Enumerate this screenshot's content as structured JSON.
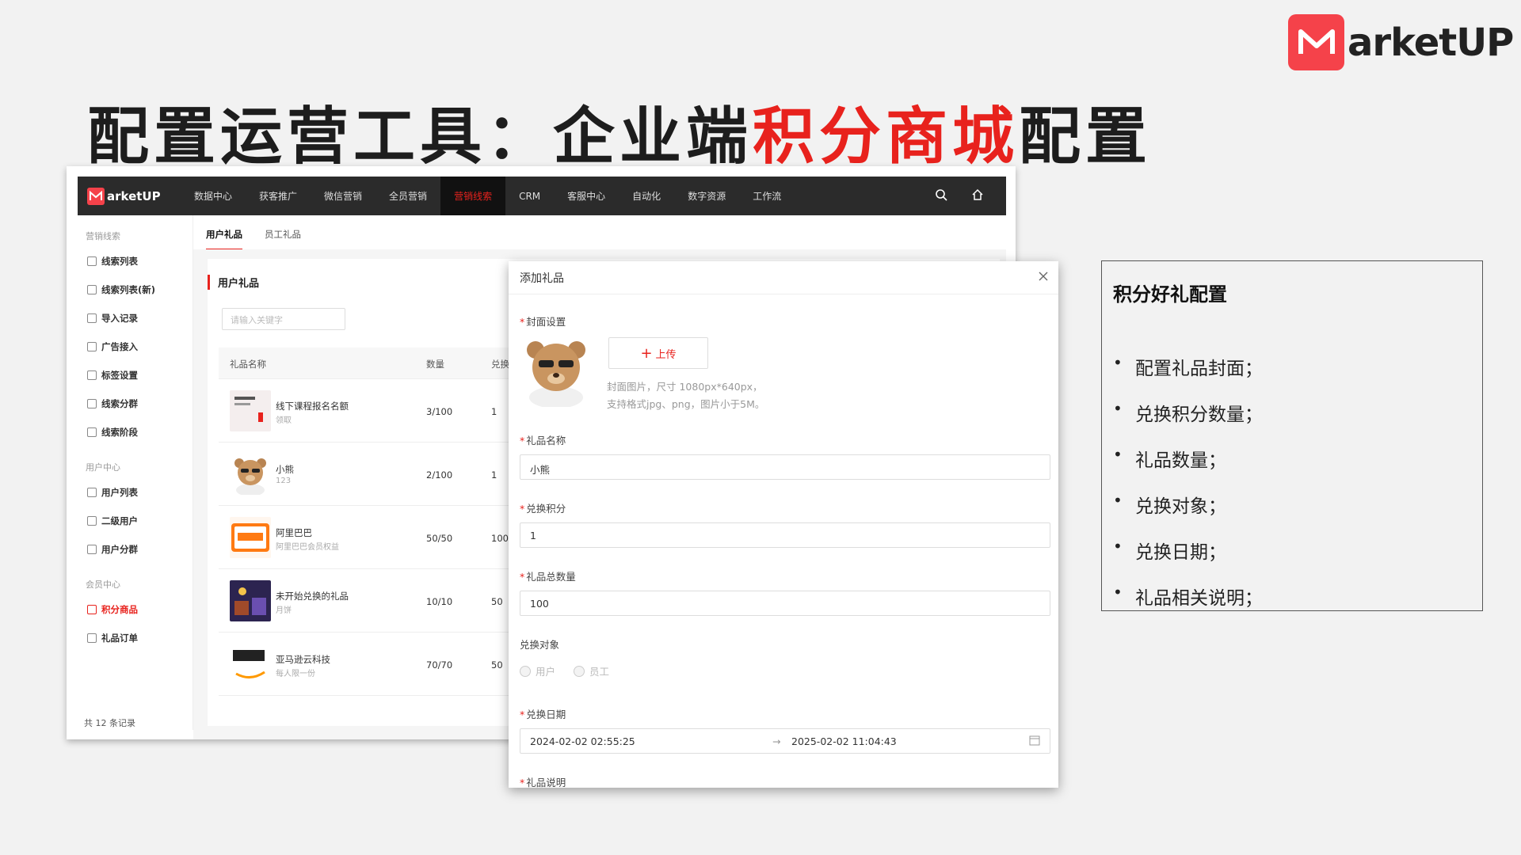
{
  "brand": {
    "name": "arketUP"
  },
  "title": {
    "prefix": "配置运营工具：企业端",
    "highlight": "积分商城",
    "suffix": "配置"
  },
  "app": {
    "nav_logo": "arketUP",
    "nav": [
      "数据中心",
      "获客推广",
      "微信营销",
      "全员营销",
      "营销线索",
      "CRM",
      "客服中心",
      "自动化",
      "数字资源",
      "工作流"
    ],
    "sidebar": {
      "groups": [
        {
          "title": "营销线索",
          "items": [
            "线索列表",
            "线索列表(新)",
            "导入记录",
            "广告接入",
            "标签设置",
            "线索分群",
            "线索阶段"
          ]
        },
        {
          "title": "用户中心",
          "items": [
            "用户列表",
            "二级用户",
            "用户分群"
          ]
        },
        {
          "title": "会员中心",
          "items": [
            "积分商品",
            "礼品订单"
          ]
        }
      ]
    },
    "tabs": [
      "用户礼品",
      "员工礼品"
    ],
    "card_title": "用户礼品",
    "search_placeholder": "请输入关键字",
    "columns": [
      "礼品名称",
      "数量",
      "兑换"
    ],
    "rows": [
      {
        "name": "线下课程报名名额",
        "sub": "领取",
        "qty": "3/100",
        "points": "1"
      },
      {
        "name": "小熊",
        "sub": "123",
        "qty": "2/100",
        "points": "1"
      },
      {
        "name": "阿里巴巴",
        "sub": "阿里巴巴会员权益",
        "qty": "50/50",
        "points": "100"
      },
      {
        "name": "未开始兑换的礼品",
        "sub": "月饼",
        "qty": "10/10",
        "points": "50"
      },
      {
        "name": "亚马逊云科技",
        "sub": "每人限一份",
        "qty": "70/70",
        "points": "50"
      }
    ],
    "total": "共 12 条记录"
  },
  "modal": {
    "title": "添加礼品",
    "cover_label": "封面设置",
    "upload_label": "上传",
    "hint1": "封面图片，尺寸 1080px*640px，",
    "hint2": "支持格式jpg、png，图片小于5M。",
    "name_label": "礼品名称",
    "name_value": "小熊",
    "points_label": "兑换积分",
    "points_value": "1",
    "total_label": "礼品总数量",
    "total_value": "100",
    "target_label": "兑换对象",
    "target_options": [
      "用户",
      "员工"
    ],
    "date_label": "兑换日期",
    "date_start": "2024-02-02 02:55:25",
    "date_end": "2025-02-02 11:04:43",
    "desc_label": "礼品说明"
  },
  "info": {
    "title": "积分好礼配置",
    "items": [
      "配置礼品封面；",
      "兑换积分数量；",
      "礼品数量；",
      "兑换对象；",
      "兑换日期；",
      "礼品相关说明；"
    ]
  },
  "colors": {
    "accent": "#e8221d",
    "nav_bg": "#2b2b2b",
    "logo_red": "#f5424a"
  },
  "icons": [
    "search-icon",
    "home-icon",
    "close-icon",
    "plus-icon",
    "calendar-icon",
    "arrow-right-icon"
  ]
}
